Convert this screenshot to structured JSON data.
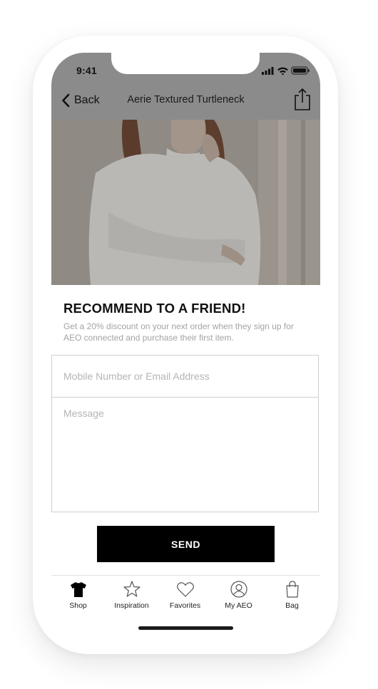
{
  "status_bar": {
    "time": "9:41"
  },
  "nav": {
    "back_label": "Back",
    "title": "Aerie Textured Turtleneck"
  },
  "content": {
    "heading": "RECOMMEND TO A FRIEND!",
    "description": "Get a 20% discount on your next order when they sign up for AEO connected and purchase their first item.",
    "contact_placeholder": "Mobile Number or Email Address",
    "contact_value": "",
    "message_placeholder": "Message",
    "message_value": "",
    "send_label": "SEND"
  },
  "tabbar": {
    "items": [
      {
        "label": "Shop",
        "icon": "tshirt-icon",
        "active": true
      },
      {
        "label": "Inspiration",
        "icon": "star-icon",
        "active": false
      },
      {
        "label": "Favorites",
        "icon": "heart-icon",
        "active": false
      },
      {
        "label": "My AEO",
        "icon": "user-circle-icon",
        "active": false
      },
      {
        "label": "Bag",
        "icon": "bag-icon",
        "active": false
      }
    ]
  },
  "colors": {
    "overlay_grey": "#8b8b8b",
    "primary": "#000000",
    "muted_text": "#a3a3a3"
  }
}
